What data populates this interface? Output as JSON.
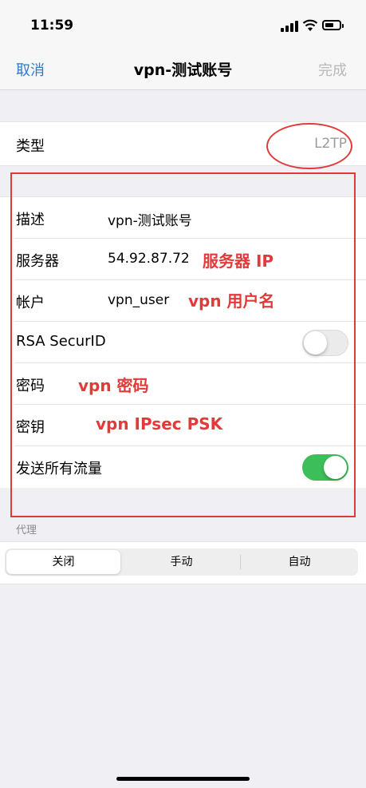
{
  "status_bar": {
    "time": "11:59"
  },
  "nav": {
    "cancel": "取消",
    "title": "vpn-测试账号",
    "done": "完成"
  },
  "type_row": {
    "label": "类型",
    "value": "L2TP"
  },
  "form": {
    "description": {
      "label": "描述",
      "value": "vpn-测试账号"
    },
    "server": {
      "label": "服务器",
      "value": "54.92.87.72",
      "annotation": "服务器 IP"
    },
    "account": {
      "label": "帐户",
      "value": "vpn_user",
      "annotation": "vpn 用户名"
    },
    "rsa": {
      "label": "RSA SecurID",
      "enabled": false
    },
    "password": {
      "label": "密码",
      "annotation": "vpn 密码"
    },
    "secret": {
      "label": "密钥",
      "annotation": "vpn IPsec PSK"
    },
    "send_all": {
      "label": "发送所有流量",
      "enabled": true
    }
  },
  "proxy": {
    "header": "代理",
    "options": [
      "关闭",
      "手动",
      "自动"
    ],
    "selected": "关闭"
  },
  "colors": {
    "accent": "#2a7ad0",
    "annotation_red": "#e23a3a",
    "toggle_on": "#3cbf5a"
  }
}
